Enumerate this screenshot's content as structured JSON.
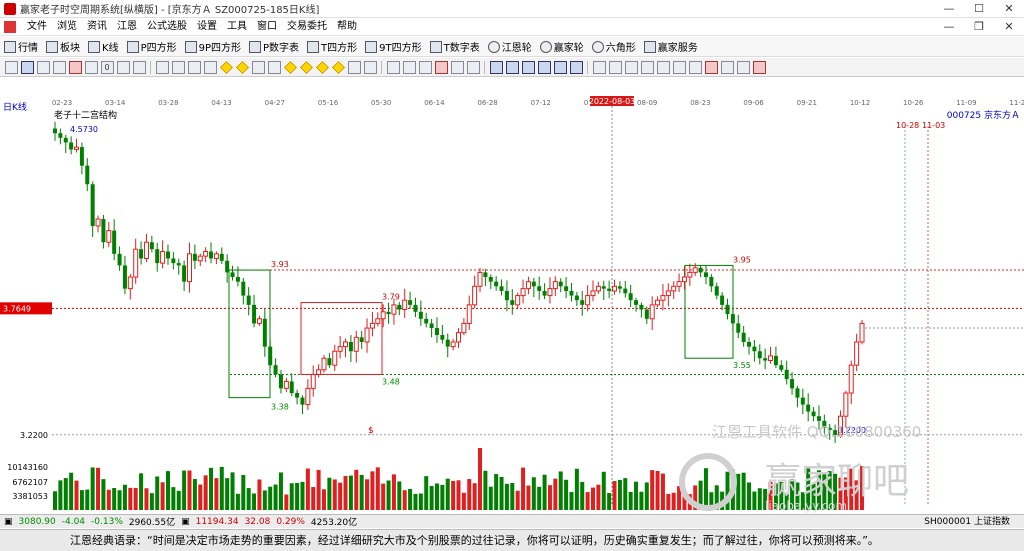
{
  "window": {
    "title": "赢家老子时空周期系统[纵横版] - [京东方Ａ  SZ000725-185日K线]",
    "minimize": "—",
    "maximize": "☐",
    "close": "✕"
  },
  "menu": {
    "items": [
      "文件",
      "浏览",
      "资讯",
      "江恩",
      "公式选股",
      "设置",
      "工具",
      "窗口",
      "交易委托",
      "帮助"
    ],
    "mdi_min": "—",
    "mdi_restore": "❐",
    "mdi_close": "✕"
  },
  "toolbar1": {
    "items": [
      "行情",
      "板块",
      "K线",
      "P四方形",
      "9P四方形",
      "P数字表",
      "T四方形",
      "9T四方形",
      "T数字表",
      "江恩轮",
      "赢家轮",
      "六角形",
      "赢家服务"
    ]
  },
  "toolbar2": {
    "zoom_value": "0"
  },
  "chart": {
    "period_label": "日K线",
    "indicator_name": "老子十二宫结构",
    "stock_code": "000725",
    "stock_name": "京东方Ａ",
    "cursor_date": "2022-08-03",
    "right_marker": "10-28",
    "right_marker2": "11-03",
    "current_price_tag": "3.7649",
    "dollar_mark": "$",
    "date_ticks": [
      "02-23",
      "03-14",
      "03-28",
      "04-13",
      "04-27",
      "05-16",
      "05-30",
      "06-14",
      "06-28",
      "07-12",
      "07-26",
      "08-09",
      "08-23",
      "09-06",
      "09-21",
      "10-12",
      "10-26",
      "11-09",
      "11-23"
    ],
    "price_labels": {
      "high": "4.5730",
      "p393": "3.93",
      "p379": "3.79",
      "p348": "3.48",
      "p338": "3.38",
      "p395": "3.95",
      "p355": "3.55",
      "low": "3.2200"
    },
    "axis_left_price": "3.2200",
    "volume_labels": [
      "10143160",
      "6762107",
      "3381053"
    ],
    "watermark_line1": "江恩工具软件 QQ:100800360",
    "watermark_line2": "赢家聊吧",
    "watermark_line3": "liaoba.yy.com",
    "colors": {
      "up": "#e02020",
      "down": "#008000",
      "box_red": "#e02020",
      "box_green": "#008000"
    },
    "chart_data": {
      "type": "candlestick",
      "series": [
        {
          "name": "price",
          "values": [
            4.52,
            4.5,
            4.48,
            4.45,
            4.46,
            4.38,
            4.3,
            4.12,
            4.15,
            4.05,
            4.1,
            4.0,
            3.95,
            3.85,
            3.9,
            4.02,
            3.98,
            4.05,
            4.02,
            3.96,
            4.01,
            3.98,
            3.96,
            3.95,
            3.88,
            4.0,
            3.97,
            3.99,
            4.01,
            3.98,
            4.0,
            3.97,
            3.92,
            3.9,
            3.88,
            3.82,
            3.78,
            3.7,
            3.72,
            3.6,
            3.52,
            3.48,
            3.42,
            3.45,
            3.4,
            3.38,
            3.35,
            3.42,
            3.48,
            3.5,
            3.55,
            3.52,
            3.58,
            3.6,
            3.62,
            3.58,
            3.64,
            3.62,
            3.68,
            3.7,
            3.72,
            3.75,
            3.74,
            3.78,
            3.76,
            3.8,
            3.78,
            3.75,
            3.72,
            3.7,
            3.68,
            3.65,
            3.63,
            3.6,
            3.62,
            3.66,
            3.7,
            3.78,
            3.86,
            3.92,
            3.9,
            3.88,
            3.86,
            3.84,
            3.8,
            3.78,
            3.82,
            3.85,
            3.88,
            3.86,
            3.84,
            3.82,
            3.85,
            3.88,
            3.86,
            3.84,
            3.82,
            3.8,
            3.78,
            3.82,
            3.84,
            3.86,
            3.85,
            3.84,
            3.86,
            3.85,
            3.83,
            3.8,
            3.78,
            3.76,
            3.72,
            3.78,
            3.8,
            3.82,
            3.84,
            3.86,
            3.88,
            3.9,
            3.92,
            3.94,
            3.92,
            3.9,
            3.86,
            3.82,
            3.78,
            3.74,
            3.7,
            3.66,
            3.62,
            3.6,
            3.58,
            3.55,
            3.54,
            3.56,
            3.52,
            3.5,
            3.46,
            3.42,
            3.38,
            3.35,
            3.32,
            3.3,
            3.28,
            3.25,
            3.24,
            3.22,
            3.3,
            3.4,
            3.52,
            3.62,
            3.7
          ]
        }
      ]
    }
  },
  "status": {
    "sh_index": "3080.90",
    "sh_change": "-4.04",
    "sh_pct": "-0.13%",
    "sh_amount": "2960.55亿",
    "sz_index": "11194.34",
    "sz_change": "32.08",
    "sz_pct": "0.29%",
    "sz_amount": "4253.20亿",
    "right_label": "SH000001 上证指数"
  },
  "quote": {
    "text": "江恩经典语录：“时间是决定市场走势的重要因素，经过详细研究大市及个别股票的过往记录，你将可以证明，历史确实重复发生；而了解过往，你将可以预测将来。”。"
  }
}
